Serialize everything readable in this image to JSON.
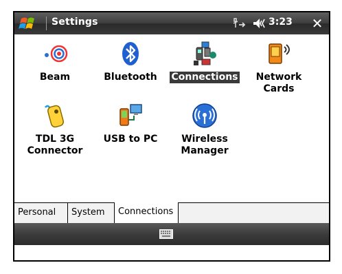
{
  "titlebar": {
    "title": "Settings",
    "time": "3:23",
    "close_glyph": "✕",
    "icons": [
      "windows-start-icon",
      "connectivity-icon",
      "volume-icon",
      "close-icon"
    ]
  },
  "items": [
    {
      "label_1": "Beam",
      "label_2": "",
      "icon": "beam-icon"
    },
    {
      "label_1": "Bluetooth",
      "label_2": "",
      "icon": "bluetooth-icon"
    },
    {
      "label_1": "Connections",
      "label_2": "",
      "icon": "connections-icon",
      "selected": true
    },
    {
      "label_1": "Network",
      "label_2": "Cards",
      "icon": "network-cards-icon"
    },
    {
      "label_1": "TDL 3G",
      "label_2": "Connector",
      "icon": "tdl-3g-connector-icon"
    },
    {
      "label_1": "USB to PC",
      "label_2": "",
      "icon": "usb-to-pc-icon"
    },
    {
      "label_1": "Wireless",
      "label_2": "Manager",
      "icon": "wireless-manager-icon"
    }
  ],
  "tabs": [
    {
      "label": "Personal"
    },
    {
      "label": "System"
    },
    {
      "label": "Connections",
      "active": true
    }
  ],
  "bottombar": {
    "icon": "keyboard-icon"
  },
  "colors": {
    "titlebar": "#3f3f3f",
    "selection": "#3a3a3a",
    "bluetooth": "#1f5fd0",
    "wireless": "#2a6fd6"
  }
}
